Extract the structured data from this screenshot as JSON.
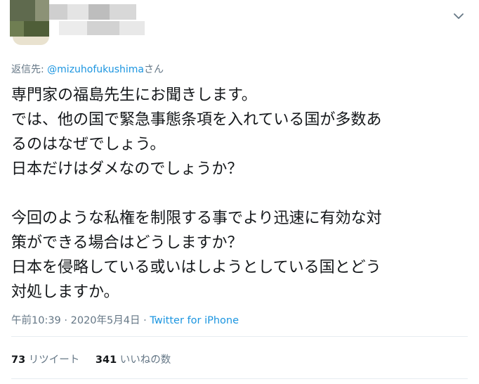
{
  "tweet": {
    "reply_prefix": "返信先: ",
    "reply_mention": "@mizuhofukushima",
    "reply_suffix": "さん",
    "lines": [
      "専門家の福島先生にお聞きします。",
      "では、他の国で緊急事態条項を入れている国が多数あ",
      "るのはなぜでしょう。",
      "日本だけはダメなのでしょうか？",
      "",
      "今回のような私権を制限する事でより迅速に有効な対",
      "策ができる場合はどうしますか？",
      "日本を侵略している或いはしようとしている国とどう",
      "対処しますか。"
    ],
    "time": "午前10:39",
    "separator": " · ",
    "date": "2020年5月4日",
    "source": "Twitter for iPhone"
  },
  "stats": {
    "retweets_count": "73",
    "retweets_label": "リツイート",
    "likes_count": "341",
    "likes_label": "いいねの数"
  },
  "icons": {
    "caret": "chevron-down-icon"
  },
  "colors": {
    "link": "#1b95e0",
    "muted": "#657786",
    "text": "#14171a",
    "divider": "#e6ecf0"
  }
}
